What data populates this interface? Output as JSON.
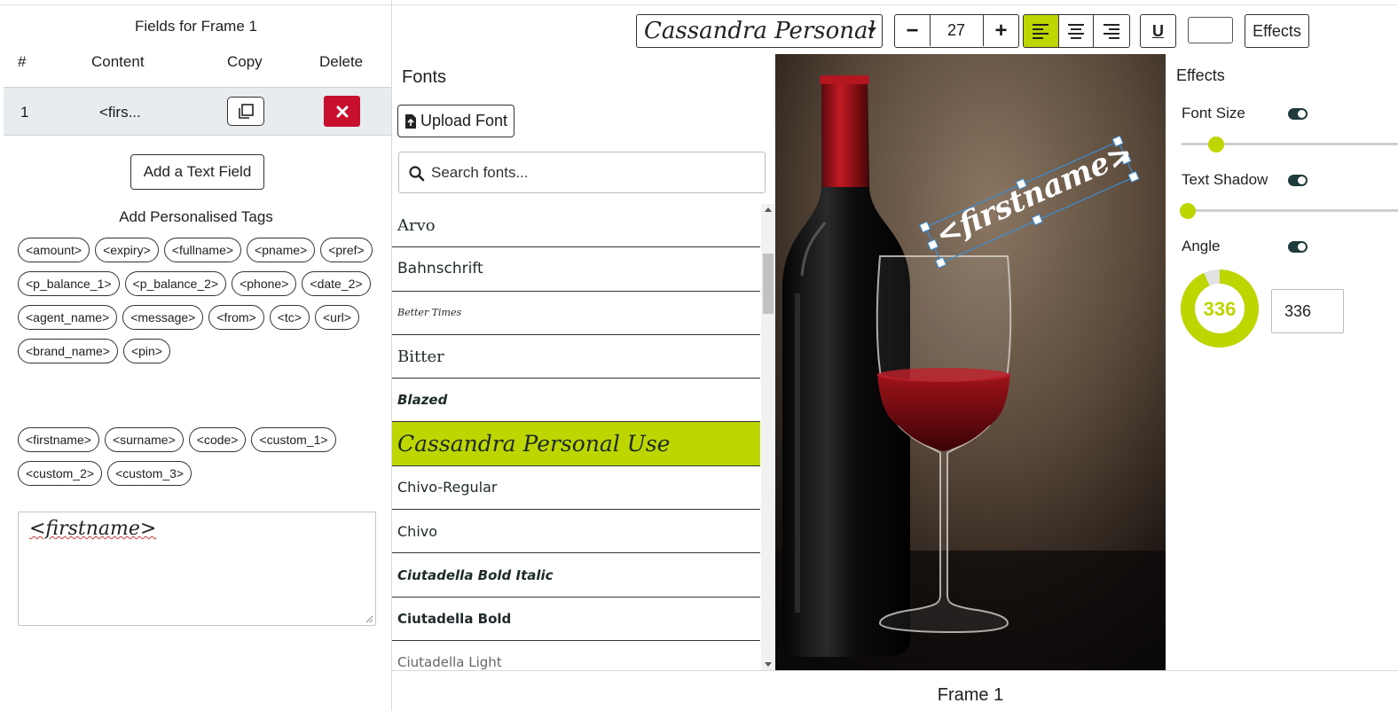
{
  "left": {
    "title": "Fields for Frame 1",
    "columns": [
      "#",
      "Content",
      "Copy",
      "Delete"
    ],
    "rows": [
      {
        "num": "1",
        "content": "<firs..."
      }
    ],
    "add_field_label": "Add a Text Field",
    "tags_title": "Add Personalised Tags",
    "tags_group1": [
      "<amount>",
      "<expiry>",
      "<fullname>",
      "<pname>",
      "<pref>",
      "<p_balance_1>",
      "<p_balance_2>",
      "<phone>",
      "<date_2>",
      "<agent_name>",
      "<message>",
      "<from>",
      "<tc>",
      "<url>",
      "<brand_name>",
      "<pin>"
    ],
    "tags_group2": [
      "<firstname>",
      "<surname>",
      "<code>",
      "<custom_1>",
      "<custom_2>",
      "<custom_3>"
    ],
    "text_value": "<firstname>"
  },
  "toolbar": {
    "font_name": "Cassandra Personal Use",
    "font_size": "27",
    "minus_label": "−",
    "plus_label": "+",
    "underline_label": "U",
    "effects_label": "Effects",
    "align_active": "left",
    "accent_color": "#bed600"
  },
  "fonts": {
    "title": "Fonts",
    "upload_label": "Upload Font",
    "search_placeholder": "Search fonts...",
    "items": [
      "Arvo",
      "Bahnschrift",
      "Better Times",
      "Bitter",
      "Blazed",
      "Cassandra Personal Use",
      "Chivo-Regular",
      "Chivo",
      "Ciutadella Bold Italic",
      "Ciutadella Bold",
      "Ciutadella Light"
    ],
    "selected": "Cassandra Personal Use"
  },
  "canvas": {
    "overlay_text": "<firstname>",
    "angle": 336
  },
  "effects": {
    "title": "Effects",
    "font_size_label": "Font Size",
    "font_size_slider": 0.12,
    "text_shadow_label": "Text Shadow",
    "text_shadow_slider": 0.0,
    "angle_label": "Angle",
    "angle_value": "336"
  },
  "footer": {
    "frame_label": "Frame 1"
  }
}
